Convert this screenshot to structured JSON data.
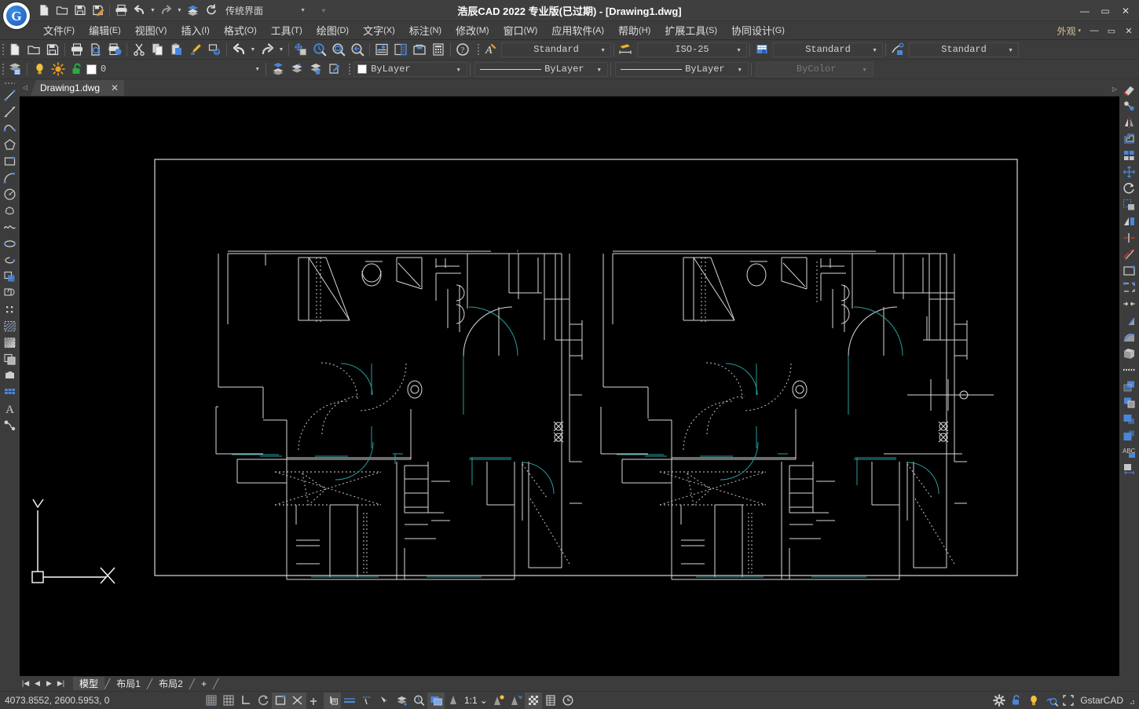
{
  "window": {
    "title": "浩辰CAD 2022 专业版(已过期) - [Drawing1.dwg]",
    "minimize": "—",
    "maximize": "▭",
    "close": "✕"
  },
  "quick_access": {
    "ui_profile": "传统界面",
    "icons": [
      "new-file-icon",
      "open-folder-icon",
      "save-icon",
      "save-as-icon",
      "print-icon",
      "undo-icon",
      "redo-icon",
      "layers-icon",
      "refresh-icon"
    ],
    "more": "▿"
  },
  "menubar": {
    "items": [
      {
        "label": "文件",
        "mnemonic": "(F)"
      },
      {
        "label": "编辑",
        "mnemonic": "(E)"
      },
      {
        "label": "视图",
        "mnemonic": "(V)"
      },
      {
        "label": "插入",
        "mnemonic": "(I)"
      },
      {
        "label": "格式",
        "mnemonic": "(O)"
      },
      {
        "label": "工具",
        "mnemonic": "(T)"
      },
      {
        "label": "绘图",
        "mnemonic": "(D)"
      },
      {
        "label": "文字",
        "mnemonic": "(X)"
      },
      {
        "label": "标注",
        "mnemonic": "(N)"
      },
      {
        "label": "修改",
        "mnemonic": "(M)"
      },
      {
        "label": "窗口",
        "mnemonic": "(W)"
      },
      {
        "label": "应用软件",
        "mnemonic": "(A)"
      },
      {
        "label": "帮助",
        "mnemonic": "(H)"
      },
      {
        "label": "扩展工具",
        "mnemonic": "(S)"
      },
      {
        "label": "协同设计",
        "mnemonic": "(G)"
      }
    ],
    "appearance": "外观",
    "appearance_caret": "▾",
    "min": "—",
    "restore": "▭",
    "close": "✕"
  },
  "toolbar_main": {
    "icons": [
      "new-file-icon",
      "open-folder-icon",
      "save-icon",
      "print-icon",
      "print-preview-icon",
      "publish-icon",
      "cut-icon",
      "copy-icon",
      "paste-icon",
      "match-properties-icon",
      "erase-properties-icon",
      "undo-icon",
      "redo-icon",
      "pan-icon",
      "zoom-realtime-icon",
      "zoom-window-icon",
      "zoom-previous-icon",
      "properties-icon",
      "designcenter-icon",
      "toolpalette-icon",
      "calculator-icon",
      "help-icon"
    ],
    "text_style": {
      "icon": "text-style-icon",
      "value": "Standard"
    },
    "dim_style": {
      "icon": "dim-style-icon",
      "value": "ISO-25"
    },
    "table_style": {
      "icon": "table-style-icon",
      "value": "Standard"
    },
    "mleader_style": {
      "icon": "mleader-style-icon",
      "value": "Standard"
    }
  },
  "toolbar_layers": {
    "layer_manager_icon": "layer-properties-icon",
    "state": {
      "on_icon": "lightbulb-icon",
      "freeze_icon": "sun-icon",
      "lock_icon": "unlock-icon",
      "color_swatch": "#ffffff",
      "name": "0"
    },
    "layer_tool_icons": [
      "make-current-icon",
      "previous-layer-icon",
      "layer-iso-icon",
      "layer-match-icon"
    ],
    "color_control": {
      "value": "ByLayer",
      "swatch": "#ffffff"
    },
    "linetype_control": {
      "value": "ByLayer"
    },
    "lineweight_control": {
      "value": "ByLayer"
    },
    "plotstyle_control": {
      "value": "ByColor",
      "disabled": true
    }
  },
  "left_toolbar": {
    "icons": [
      "line-icon",
      "construction-line-icon",
      "polyline-icon",
      "polygon-icon",
      "rectangle-icon",
      "arc-icon",
      "circle-icon",
      "revision-cloud-icon",
      "spline-icon",
      "ellipse-icon",
      "ellipse-arc-icon",
      "insert-block-icon",
      "make-block-icon",
      "point-icon",
      "hatch-icon",
      "gradient-icon",
      "region-icon",
      "table-icon",
      "multiline-text-icon",
      "add-selected-icon"
    ]
  },
  "right_toolbar": {
    "icons": [
      "erase-icon",
      "copy-object-icon",
      "mirror-icon",
      "offset-icon",
      "array-icon",
      "move-icon",
      "rotate-icon",
      "scale-icon",
      "stretch-icon",
      "trim-icon",
      "extend-icon",
      "break-at-point-icon",
      "break-icon",
      "join-icon",
      "chamfer-icon",
      "fillet-icon",
      "explode-icon",
      "divide-icon",
      "bring-to-front-icon",
      "send-to-back-icon",
      "bring-above-icon",
      "send-below-icon",
      "text-edit-icon",
      "edit-hatch-icon"
    ]
  },
  "document_tabs": {
    "left_arrow": "◁",
    "right_arrow": "▷",
    "tabs": [
      {
        "label": "Drawing1.dwg",
        "close": "✕",
        "active": true
      }
    ]
  },
  "layout_tabs": {
    "nav": [
      "|◀",
      "◀",
      "▶",
      "▶|"
    ],
    "tabs": [
      {
        "label": "模型",
        "active": true
      },
      {
        "label": "布局1",
        "active": false
      },
      {
        "label": "布局2",
        "active": false
      },
      {
        "label": "+",
        "active": false
      }
    ]
  },
  "statusbar": {
    "coordinates": "4073.8552, 2600.5953, 0",
    "toggles": [
      {
        "name": "snap-grid-icon",
        "on": false
      },
      {
        "name": "grid-display-icon",
        "on": false
      },
      {
        "name": "ortho-mode-icon",
        "on": false
      },
      {
        "name": "polar-tracking-icon",
        "on": false
      },
      {
        "name": "object-snap-icon",
        "on": true
      },
      {
        "name": "osnap-tracking-icon",
        "on": true
      },
      {
        "name": "dynamic-ucs-icon",
        "on": false
      },
      {
        "name": "dynamic-input-icon",
        "on": true
      },
      {
        "name": "lineweight-icon",
        "on": false
      },
      {
        "name": "transparency-icon",
        "on": false
      },
      {
        "name": "quick-properties-icon",
        "on": false
      },
      {
        "name": "selection-cycling-icon",
        "on": false
      },
      {
        "name": "annotation-visibility-icon",
        "on": false
      },
      {
        "name": "model-space-icon",
        "on": true
      }
    ],
    "scale": "1:1",
    "scale_caret": "⌄",
    "extra_icons": [
      "annotation-scale-add-icon",
      "annotation-scale-sync-icon",
      "isolate-objects-icon",
      "layout-grid-icon",
      "clean-screen-icon"
    ],
    "right_icons": [
      "settings-gear-icon",
      "lock-toolbars-icon",
      "lightbulb-status-icon",
      "cleanscreen-icon",
      "fullscreen-icon"
    ],
    "product": "GstarCAD"
  },
  "canvas": {
    "background": "#000000",
    "drawing_name": "floor-plan-apartment-pair",
    "line_color": "#d8d8d8",
    "accent_color": "#2a9d9d",
    "ucs": {
      "x_label": "X",
      "y_label": "Y"
    }
  }
}
